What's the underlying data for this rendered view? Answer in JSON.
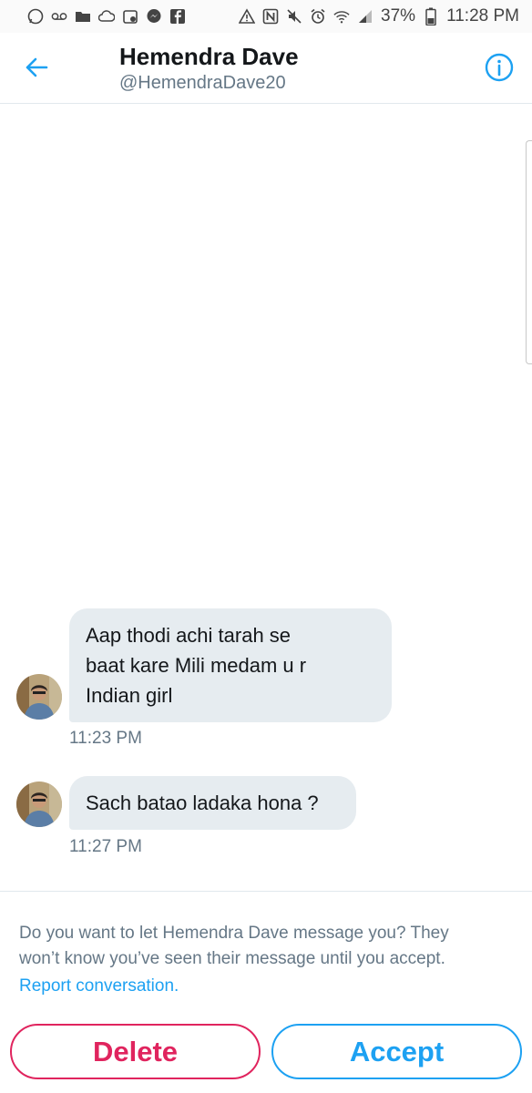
{
  "status_bar": {
    "battery_percent": "37%",
    "time": "11:28 PM",
    "icons_left": [
      "whatsapp-icon",
      "voicemail-icon",
      "folder-icon",
      "cloud-icon",
      "calendar-icon",
      "messenger-icon",
      "facebook-icon"
    ],
    "icons_right": [
      "alert-icon",
      "nfc-icon",
      "mute-icon",
      "alarm-icon",
      "wifi-icon",
      "signal-icon",
      "battery-icon"
    ]
  },
  "header": {
    "name": "Hemendra Dave",
    "handle": "@HemendraDave20"
  },
  "messages": [
    {
      "lines": [
        "Aap thodi achi tarah se",
        "baat kare Mili medam u r",
        "Indian girl"
      ],
      "time": "11:23 PM"
    },
    {
      "lines": [
        "Sach batao ladaka hona ?"
      ],
      "time": "11:27 PM"
    }
  ],
  "request": {
    "prompt_line1": "Do you want to let Hemendra Dave message you? They",
    "prompt_line2": "won’t know you’ve seen their message until you accept.",
    "report_label": "Report conversation.",
    "delete_label": "Delete",
    "accept_label": "Accept"
  },
  "colors": {
    "accent": "#1da1f2",
    "danger": "#e0245e",
    "bubble": "#e6ecf0",
    "muted": "#657786"
  }
}
